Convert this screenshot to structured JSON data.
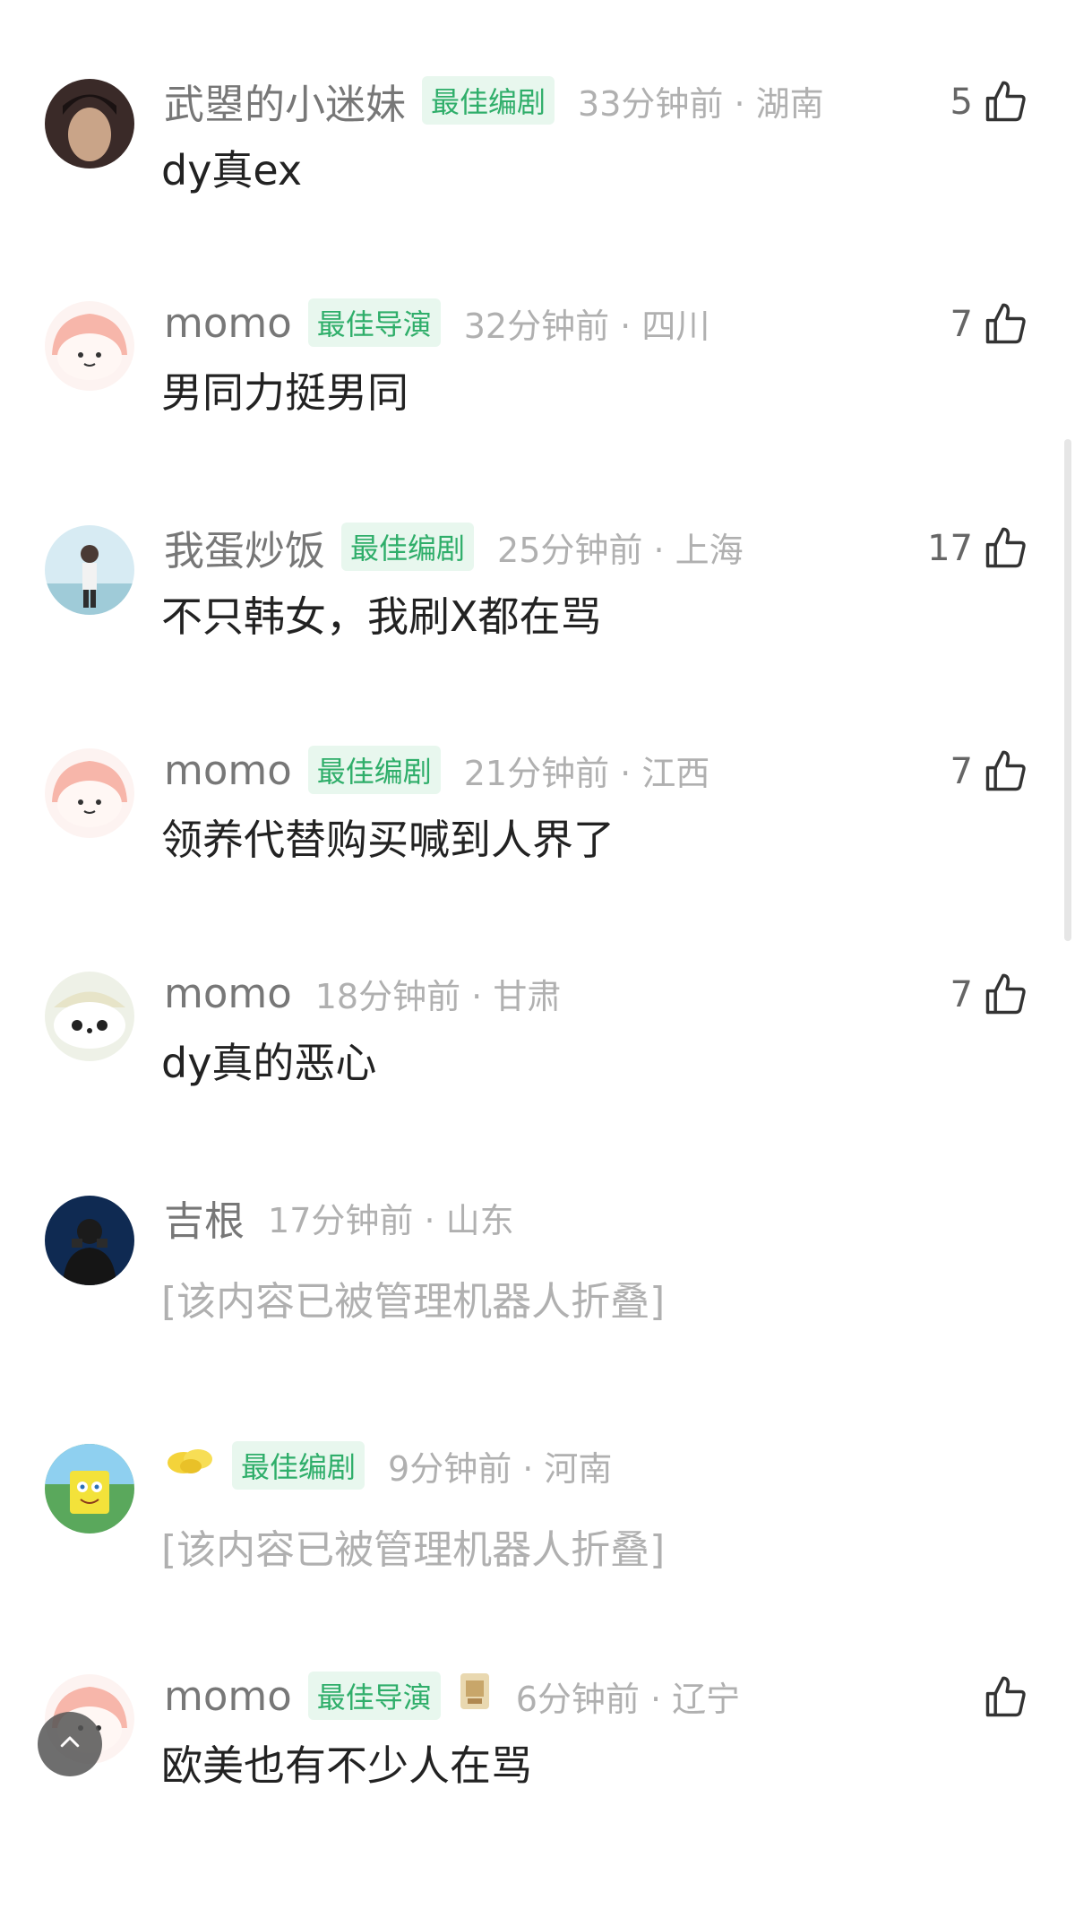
{
  "comments": [
    {
      "user": "武曌的小迷妹",
      "badge": "最佳编剧",
      "time": "33分钟前 · 湖南",
      "likes": "5",
      "text": "dy真ex"
    },
    {
      "user": "momo",
      "badge": "最佳导演",
      "time": "32分钟前 · 四川",
      "likes": "7",
      "text": "男同力挺男同"
    },
    {
      "user": "我蛋炒饭",
      "badge": "最佳编剧",
      "time": "25分钟前 · 上海",
      "likes": "17",
      "text": "不只韩女，我刷X都在骂"
    },
    {
      "user": "momo",
      "badge": "最佳编剧",
      "time": "21分钟前 · 江西",
      "likes": "7",
      "text": "领养代替购买喊到人界了"
    },
    {
      "user": "momo",
      "time": "18分钟前 · 甘肃",
      "likes": "7",
      "text": "dy真的恶心"
    },
    {
      "user": "吉根",
      "time": "17分钟前 · 山东",
      "text": "[该内容已被管理机器人折叠]"
    },
    {
      "badge": "最佳编剧",
      "time": "9分钟前 · 河南",
      "text": "[该内容已被管理机器人折叠]"
    },
    {
      "user": "momo",
      "badge": "最佳导演",
      "time": "6分钟前 · 辽宁",
      "text": "欧美也有不少人在骂"
    }
  ],
  "icons": {
    "like": "thumbs-up-icon",
    "scroll_top": "chevron-up-icon"
  },
  "colors": {
    "badge_text": "#2fae6a",
    "badge_bg": "#e8f7ee",
    "meta": "#b0b0b0",
    "username": "#777777",
    "text": "#222222"
  }
}
